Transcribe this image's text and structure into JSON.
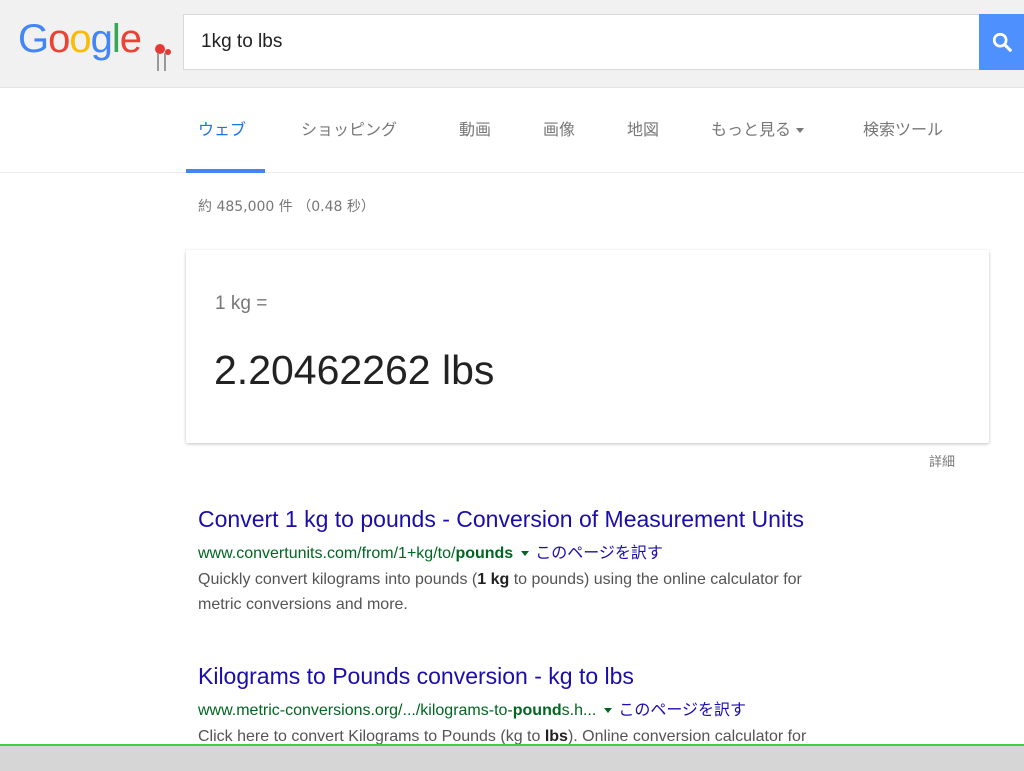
{
  "logo": {
    "letters": [
      "G",
      "o",
      "o",
      "g",
      "l",
      "e"
    ],
    "colors": [
      "#4285f4",
      "#ea4335",
      "#fbbc05",
      "#4285f4",
      "#34a853",
      "#ea4335"
    ]
  },
  "search": {
    "value": "1kg to lbs"
  },
  "tabs": [
    {
      "label": "ウェブ",
      "active": true
    },
    {
      "label": "ショッピング"
    },
    {
      "label": "動画"
    },
    {
      "label": "画像"
    },
    {
      "label": "地図"
    },
    {
      "label": "もっと見る"
    },
    {
      "label": "検索ツール"
    }
  ],
  "stats": "約 485,000 件 （0.48 秒）",
  "converter": {
    "input_text": "1 kg =",
    "output_text": "2.20462262 lbs",
    "details_label": "詳細"
  },
  "results": [
    {
      "title": "Convert 1 kg to pounds - Conversion of Measurement Units",
      "url_prefix": "www.convertunits.com/from/1+kg/to/",
      "url_bold": "pounds",
      "url_suffix": "",
      "translate": "このページを訳す",
      "snippet_1": "Quickly convert kilograms into pounds (",
      "snippet_bold": "1 kg",
      "snippet_2": " to pounds) using the online calculator for",
      "snippet_3": "metric conversions and more."
    },
    {
      "title": "Kilograms to Pounds conversion - kg to lbs",
      "url_prefix": "www.metric-conversions.org/.../kilograms-to-",
      "url_bold": "pound",
      "url_suffix": "s.h...",
      "translate": "このページを訳す",
      "snippet_1": "Click here to convert Kilograms to Pounds (kg to ",
      "snippet_bold": "lbs",
      "snippet_2": "). Online conversion calculator for",
      "snippet_3": ""
    }
  ],
  "colors": {
    "link": "#1a0dab",
    "url": "#006621",
    "accent": "#4285f4",
    "search_button": "#4d90fe"
  }
}
